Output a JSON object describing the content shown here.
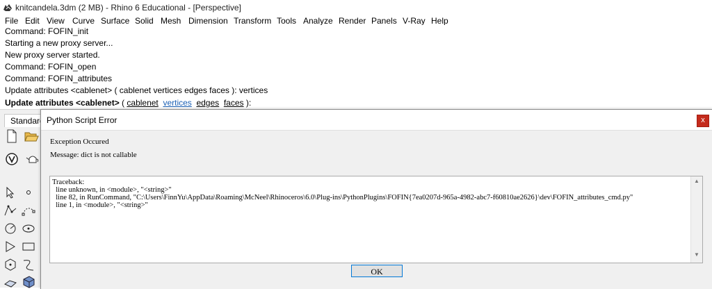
{
  "window": {
    "title": "knitcandela.3dm (2 MB) - Rhino 6 Educational - [Perspective]"
  },
  "menu": [
    "File",
    "Edit",
    "View",
    "Curve",
    "Surface",
    "Solid",
    "Mesh",
    "Dimension",
    "Transform",
    "Tools",
    "Analyze",
    "Render",
    "Panels",
    "V-Ray",
    "Help"
  ],
  "history": [
    "Command: FOFIN_init",
    "Starting a new proxy server...",
    "New proxy server started.",
    "Command: FOFIN_open",
    "Command: FOFIN_attributes",
    "Update attributes <cablenet> ( cablenet  vertices  edges  faces ): vertices"
  ],
  "prompt": {
    "label": "Update attributes <cablenet>",
    "open": " ( ",
    "opt1": "cablenet",
    "opt2": "vertices",
    "opt3": "edges",
    "opt4": "faces",
    "close": " ):"
  },
  "toolbar": {
    "tab": "Standard"
  },
  "dialog": {
    "title": "Python Script Error",
    "close": "x",
    "exception": "Exception Occured",
    "message": "Message: dict is not callable",
    "traceback": "Traceback:\n  line unknown, in <module>, \"<string>\"\n  line 82, in RunCommand, \"C:\\Users\\FinnYu\\AppData\\Roaming\\McNeel\\Rhinoceros\\6.0\\Plug-ins\\PythonPlugins\\FOFIN{7ea0207d-965a-4982-abc7-f60810ae2626}\\dev\\FOFIN_attributes_cmd.py\"\n  line 1, in <module>, \"<string>\"",
    "ok": "OK"
  }
}
